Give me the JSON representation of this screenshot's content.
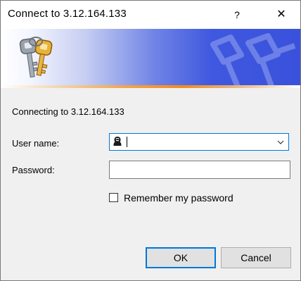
{
  "window": {
    "title": "Connect to 3.12.164.133",
    "help_glyph": "?",
    "close_glyph": "✕"
  },
  "banner": {
    "icon": "keys-icon",
    "watermark": "keys-watermark-icon",
    "colors": {
      "gradient_start": "#ffffff",
      "gradient_end": "#3a52db",
      "stripe": "#f28c1e"
    }
  },
  "form": {
    "connecting_text": "Connecting to 3.12.164.133",
    "username_label": "User name:",
    "username_value": "",
    "password_label": "Password:",
    "password_value": "",
    "remember_label": "Remember my password",
    "remember_checked": false
  },
  "buttons": {
    "ok_label": "OK",
    "cancel_label": "Cancel"
  },
  "colors": {
    "focus_accent": "#0078d7",
    "dialog_background": "#f0f0f0"
  }
}
